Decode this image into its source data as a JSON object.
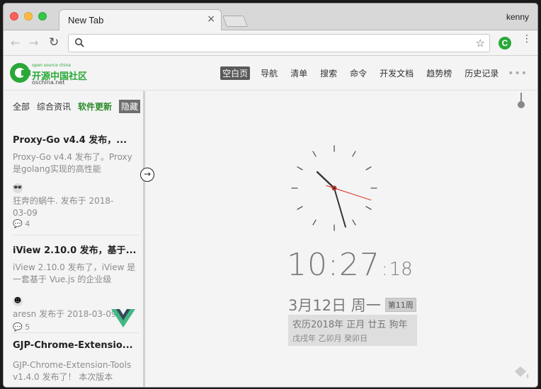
{
  "window": {
    "tab_title": "New Tab",
    "tab_close": "×",
    "profile_name": "kenny"
  },
  "toolbar": {
    "back_icon": "←",
    "forward_icon": "→",
    "reload_icon": "↻",
    "omnibox_value": "",
    "star_icon": "☆",
    "extension_letter": "C",
    "menu_icon": "⋮"
  },
  "header": {
    "logo_small": "open source china",
    "logo_name": "开源中国社区",
    "logo_domain": "oschina.net",
    "nav": [
      {
        "label": "空白页",
        "active": true
      },
      {
        "label": "导航"
      },
      {
        "label": "清单"
      },
      {
        "label": "搜索"
      },
      {
        "label": "命令"
      },
      {
        "label": "开发文档"
      },
      {
        "label": "趋势榜"
      },
      {
        "label": "历史记录"
      }
    ],
    "more": "•••"
  },
  "sidebar": {
    "tabs": [
      "全部",
      "综合资讯",
      "软件更新"
    ],
    "hide_label": "隐藏",
    "items": [
      {
        "title": "Proxy-Go v4.4 发布，...",
        "summary": "Proxy-Go v4.4 发布了。Proxy 是golang实现的高性能",
        "avatar": "🕶",
        "author": "狂奔的蜗牛. 发布于 2018-03-09",
        "comments": "4"
      },
      {
        "title": "iView 2.10.0 发布，基于...",
        "summary": "iView 2.10.0 发布了，iView 是一套基于 Vue.js 的企业级",
        "avatar": "☻",
        "author": "aresn 发布于 2018-03-09",
        "comments": "5"
      },
      {
        "title": "GJP-Chrome-Extensio...",
        "summary": "GJP-Chrome-Extension-Tools v1.4.0 发布了！ 本次版本"
      }
    ],
    "comment_icon": "💬"
  },
  "clock": {
    "hours": "10",
    "minutes": "27",
    "seconds": "18",
    "separator": ":",
    "date": "3月12日 周一",
    "week": "第11周",
    "lunar_line1": "农历2018年 正月 廿五 狗年",
    "lunar_line2": "戊戌年 乙卯月 癸卯日"
  },
  "collapse_icon": "→",
  "colors": {
    "brand_green": "#2aa839",
    "active_nav": "#5a5a5a",
    "second_hand": "#e03a2e"
  }
}
